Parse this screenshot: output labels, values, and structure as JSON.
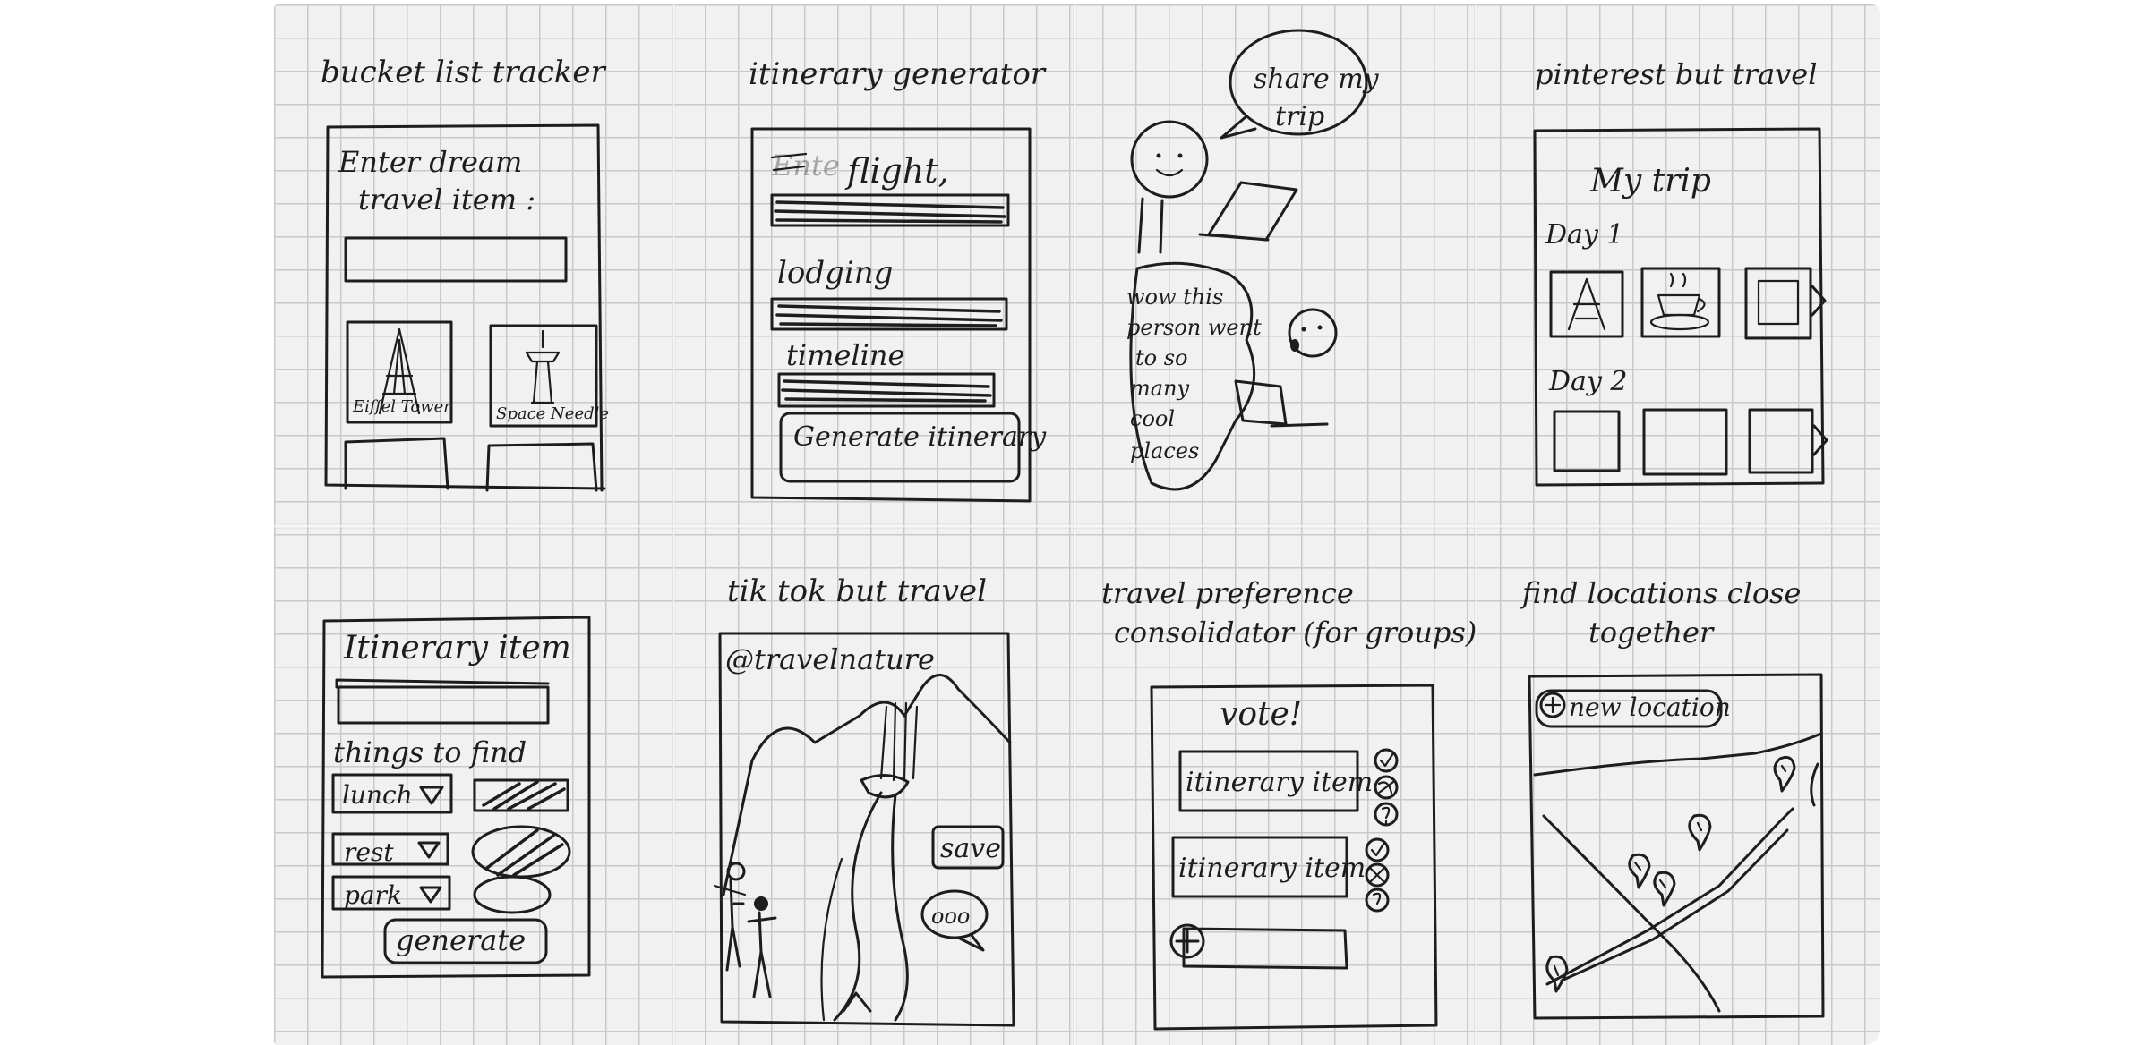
{
  "sketches": {
    "bucket_list": {
      "title": "bucket list tracker",
      "prompt_line1": "Enter dream",
      "prompt_line2": "travel item :",
      "card1_label": "Eiffel Tower",
      "card2_label": "Space Needle"
    },
    "itinerary_generator": {
      "title": "itinerary generator",
      "field1": "flight,",
      "field2": "lodging",
      "field3": "timeline",
      "button": "Generate itinerary"
    },
    "share_trip": {
      "bubble1_line1": "share my",
      "bubble1_line2": "trip",
      "bubble2_lines": [
        "wow this",
        "person went",
        "to so",
        "many",
        "cool",
        "places"
      ]
    },
    "pinterest_travel": {
      "title": "pinterest but travel",
      "heading": "My trip",
      "day1": "Day 1",
      "day2": "Day 2"
    },
    "itinerary_items": {
      "heading": "Itinerary item",
      "subheading": "things to find",
      "option1": "lunch",
      "option2": "rest",
      "option3": "park",
      "button": "generate"
    },
    "tiktok_travel": {
      "title": "tik tok but travel",
      "handle": "@travelnature",
      "save": "save",
      "more": "ooo"
    },
    "preference_consolidator": {
      "title_line1": "travel preference",
      "title_line2": "consolidator (for groups)",
      "heading": "vote!",
      "item1": "itinerary item",
      "item2": "itinerary item",
      "add": "+"
    },
    "find_locations": {
      "title_line1": "find locations close",
      "title_line2": "together",
      "new_location": "new location",
      "add": "+"
    }
  }
}
